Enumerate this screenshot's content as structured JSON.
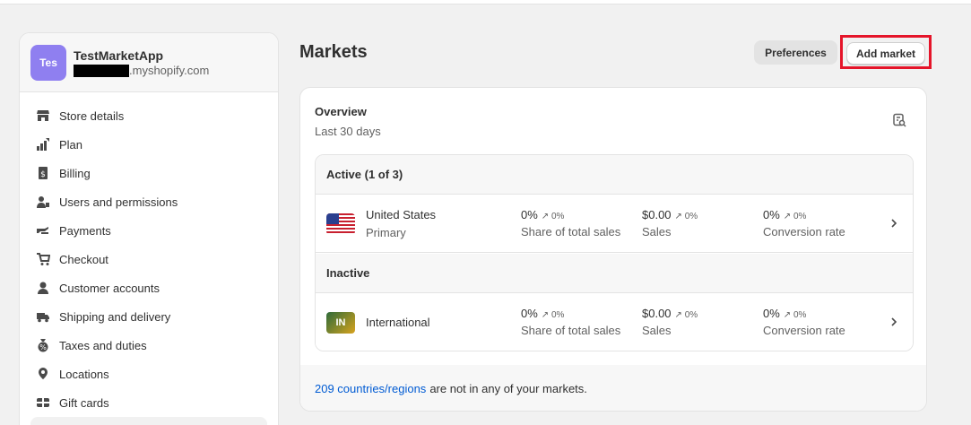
{
  "store": {
    "avatar_initials": "Tes",
    "name": "TestMarketApp",
    "domain_suffix": ".myshopify.com"
  },
  "sidebar": {
    "items": [
      {
        "label": "Store details",
        "icon": "store-icon"
      },
      {
        "label": "Plan",
        "icon": "plan-icon"
      },
      {
        "label": "Billing",
        "icon": "billing-icon"
      },
      {
        "label": "Users and permissions",
        "icon": "users-icon"
      },
      {
        "label": "Payments",
        "icon": "payments-icon"
      },
      {
        "label": "Checkout",
        "icon": "cart-icon"
      },
      {
        "label": "Customer accounts",
        "icon": "person-icon"
      },
      {
        "label": "Shipping and delivery",
        "icon": "truck-icon"
      },
      {
        "label": "Taxes and duties",
        "icon": "tax-icon"
      },
      {
        "label": "Locations",
        "icon": "location-icon"
      },
      {
        "label": "Gift cards",
        "icon": "gift-icon"
      }
    ]
  },
  "page": {
    "title": "Markets",
    "preferences_label": "Preferences",
    "add_market_label": "Add market"
  },
  "overview": {
    "title": "Overview",
    "subtitle": "Last 30 days",
    "icon": "report-icon"
  },
  "sections": {
    "active_label": "Active (1 of 3)",
    "inactive_label": "Inactive"
  },
  "markets": [
    {
      "name": "United States",
      "sub": "Primary",
      "flag": "us-flag-icon",
      "share": "0%",
      "share_trend": "↗ 0%",
      "share_label": "Share of total sales",
      "sales": "$0.00",
      "sales_trend": "↗ 0%",
      "sales_label": "Sales",
      "conv": "0%",
      "conv_trend": "↗ 0%",
      "conv_label": "Conversion rate"
    },
    {
      "name": "International",
      "sub": "",
      "flag_text": "IN",
      "share": "0%",
      "share_trend": "↗ 0%",
      "share_label": "Share of total sales",
      "sales": "$0.00",
      "sales_trend": "↗ 0%",
      "sales_label": "Sales",
      "conv": "0%",
      "conv_trend": "↗ 0%",
      "conv_label": "Conversion rate"
    }
  ],
  "footer": {
    "link_text": "209 countries/regions",
    "rest_text": "are not in any of your markets."
  },
  "colors": {
    "accent_link": "#005bd3",
    "avatar": "#8f7ff0",
    "highlight_border": "#e5152a"
  }
}
